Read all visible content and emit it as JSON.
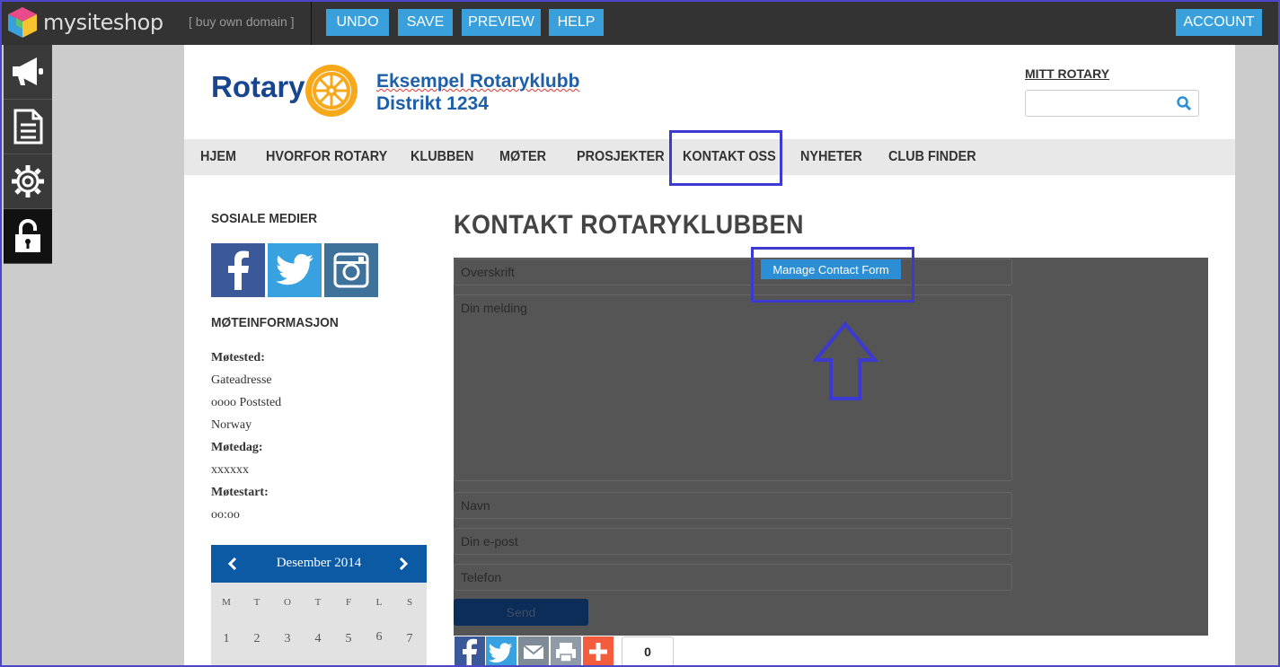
{
  "toolbar": {
    "brand": "mysiteshop",
    "buy_domain": "[ buy own domain ]",
    "undo": "UNDO",
    "save": "SAVE",
    "preview": "PREVIEW",
    "help": "HELP",
    "account": "ACCOUNT"
  },
  "colors": {
    "accent": "#3aa0db",
    "rotary_blue": "#17458f",
    "rotary_gold": "#f7a81b",
    "highlight": "#3c3ad0"
  },
  "header": {
    "logo_text": "Rotary",
    "club_line1": "Eksempel Rotaryklubb",
    "club_line2": "Distrikt 1234",
    "mitt_rotary": "MITT ROTARY",
    "search_placeholder": ""
  },
  "nav": [
    "HJEM",
    "HVORFOR ROTARY",
    "KLUBBEN",
    "MØTER",
    "PROSJEKTER",
    "KONTAKT OSS",
    "NYHETER",
    "CLUB FINDER"
  ],
  "sidebar": {
    "social_heading": "SOSIALE MEDIER",
    "meeting_heading": "MØTEINFORMASJON",
    "place_label": "Møtested:",
    "address": "Gateadresse",
    "postal": "oooo Poststed",
    "country": "Norway",
    "day_label": "Møtedag:",
    "day_value": "xxxxxx",
    "start_label": "Møtestart:",
    "start_value": "oo:oo"
  },
  "calendar": {
    "month": "Desember 2014",
    "weekdays": [
      "M",
      "T",
      "O",
      "T",
      "F",
      "L",
      "S"
    ],
    "days": [
      "1",
      "2",
      "3",
      "4",
      "5",
      "6",
      "7"
    ]
  },
  "main": {
    "title": "KONTAKT ROTARYKLUBBEN",
    "manage_button": "Manage Contact Form",
    "subject_placeholder": "Overskrift",
    "message_placeholder": "Din melding",
    "name_placeholder": "Navn",
    "email_placeholder": "Din e-post",
    "phone_placeholder": "Telefon",
    "send": "Send",
    "share_count": "0"
  }
}
